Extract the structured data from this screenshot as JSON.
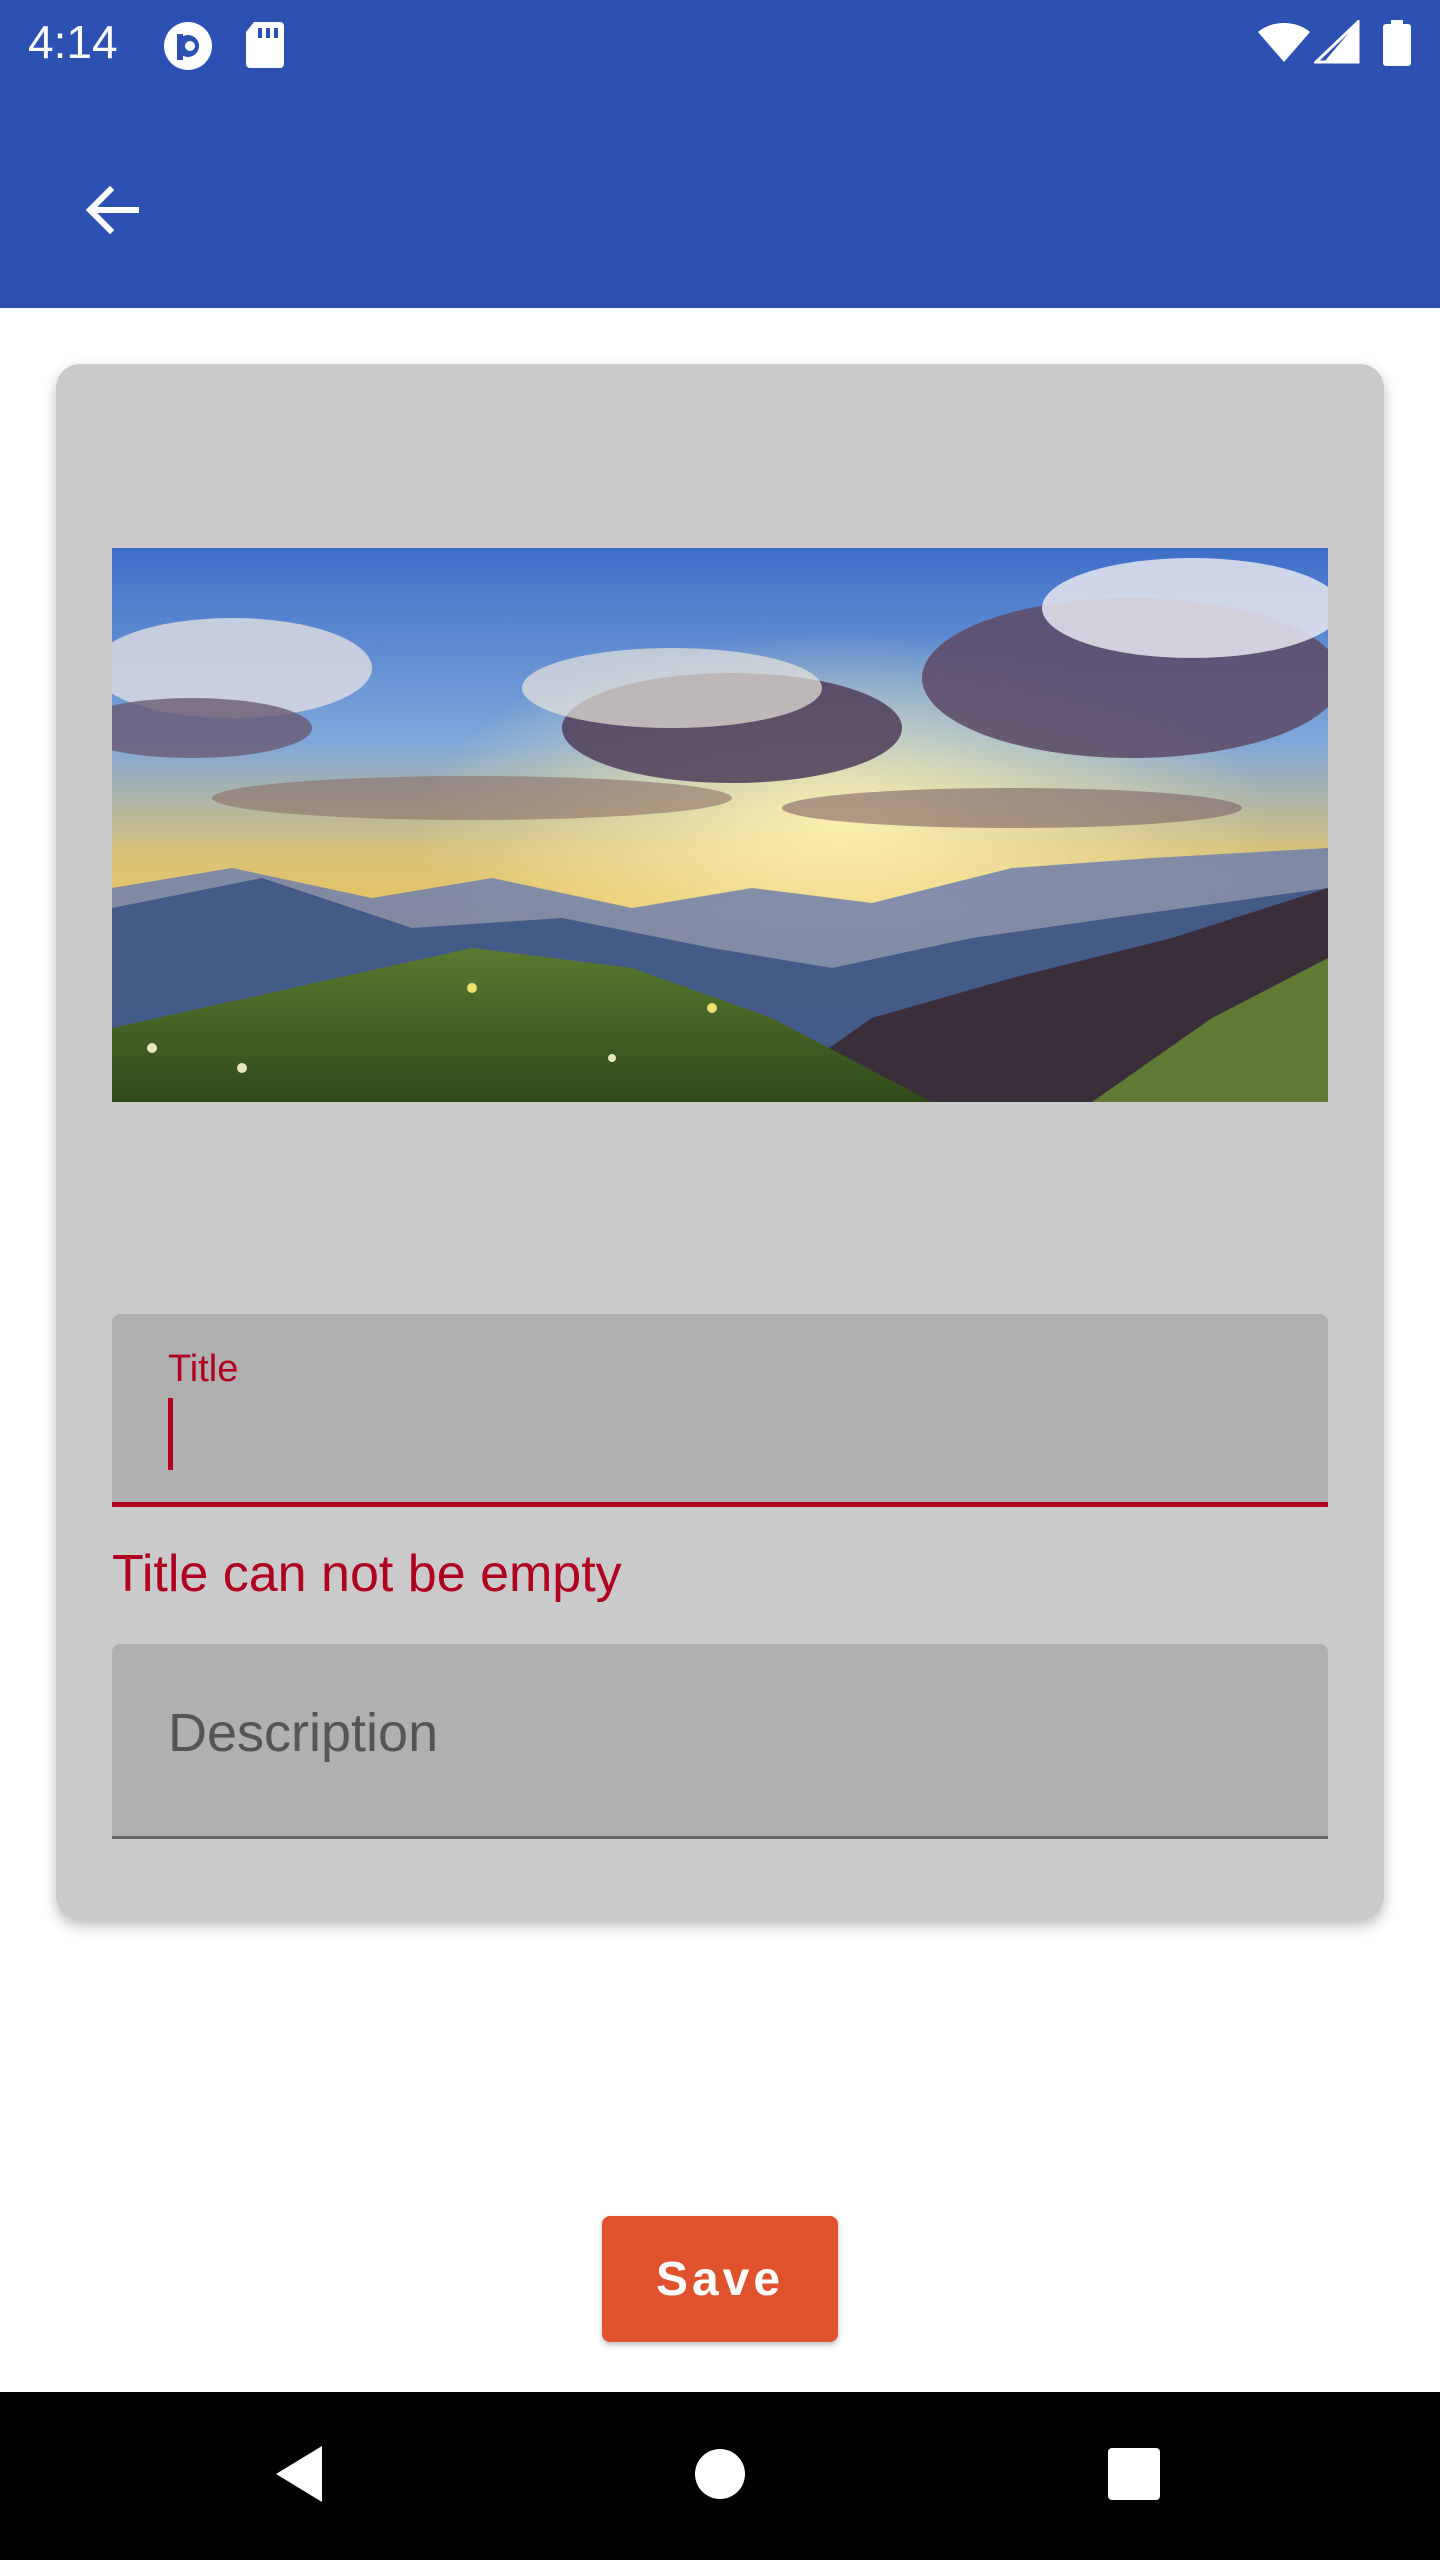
{
  "status_bar": {
    "time": "4:14",
    "left_icons": [
      "pocket-casts-icon",
      "sd-card-icon"
    ],
    "right_icons": [
      "wifi-icon",
      "cell-signal-icon",
      "battery-icon"
    ],
    "background": "#2d50b3"
  },
  "app_bar": {
    "back_icon": "arrow-back-icon",
    "background": "#2d50b3"
  },
  "card": {
    "image": "mountain-sunset-image",
    "title_field": {
      "label": "Title",
      "value": "",
      "error": "Title can not be empty"
    },
    "description_field": {
      "placeholder": "Description",
      "value": ""
    }
  },
  "save_button": {
    "label": "Save",
    "color": "#e0522e"
  },
  "nav_bar": {
    "items": [
      "back-triangle-icon",
      "home-circle-icon",
      "recents-square-icon"
    ]
  },
  "colors": {
    "error": "#b00020",
    "card_bg": "#cacaca",
    "field_bg": "#b0b0b0"
  }
}
